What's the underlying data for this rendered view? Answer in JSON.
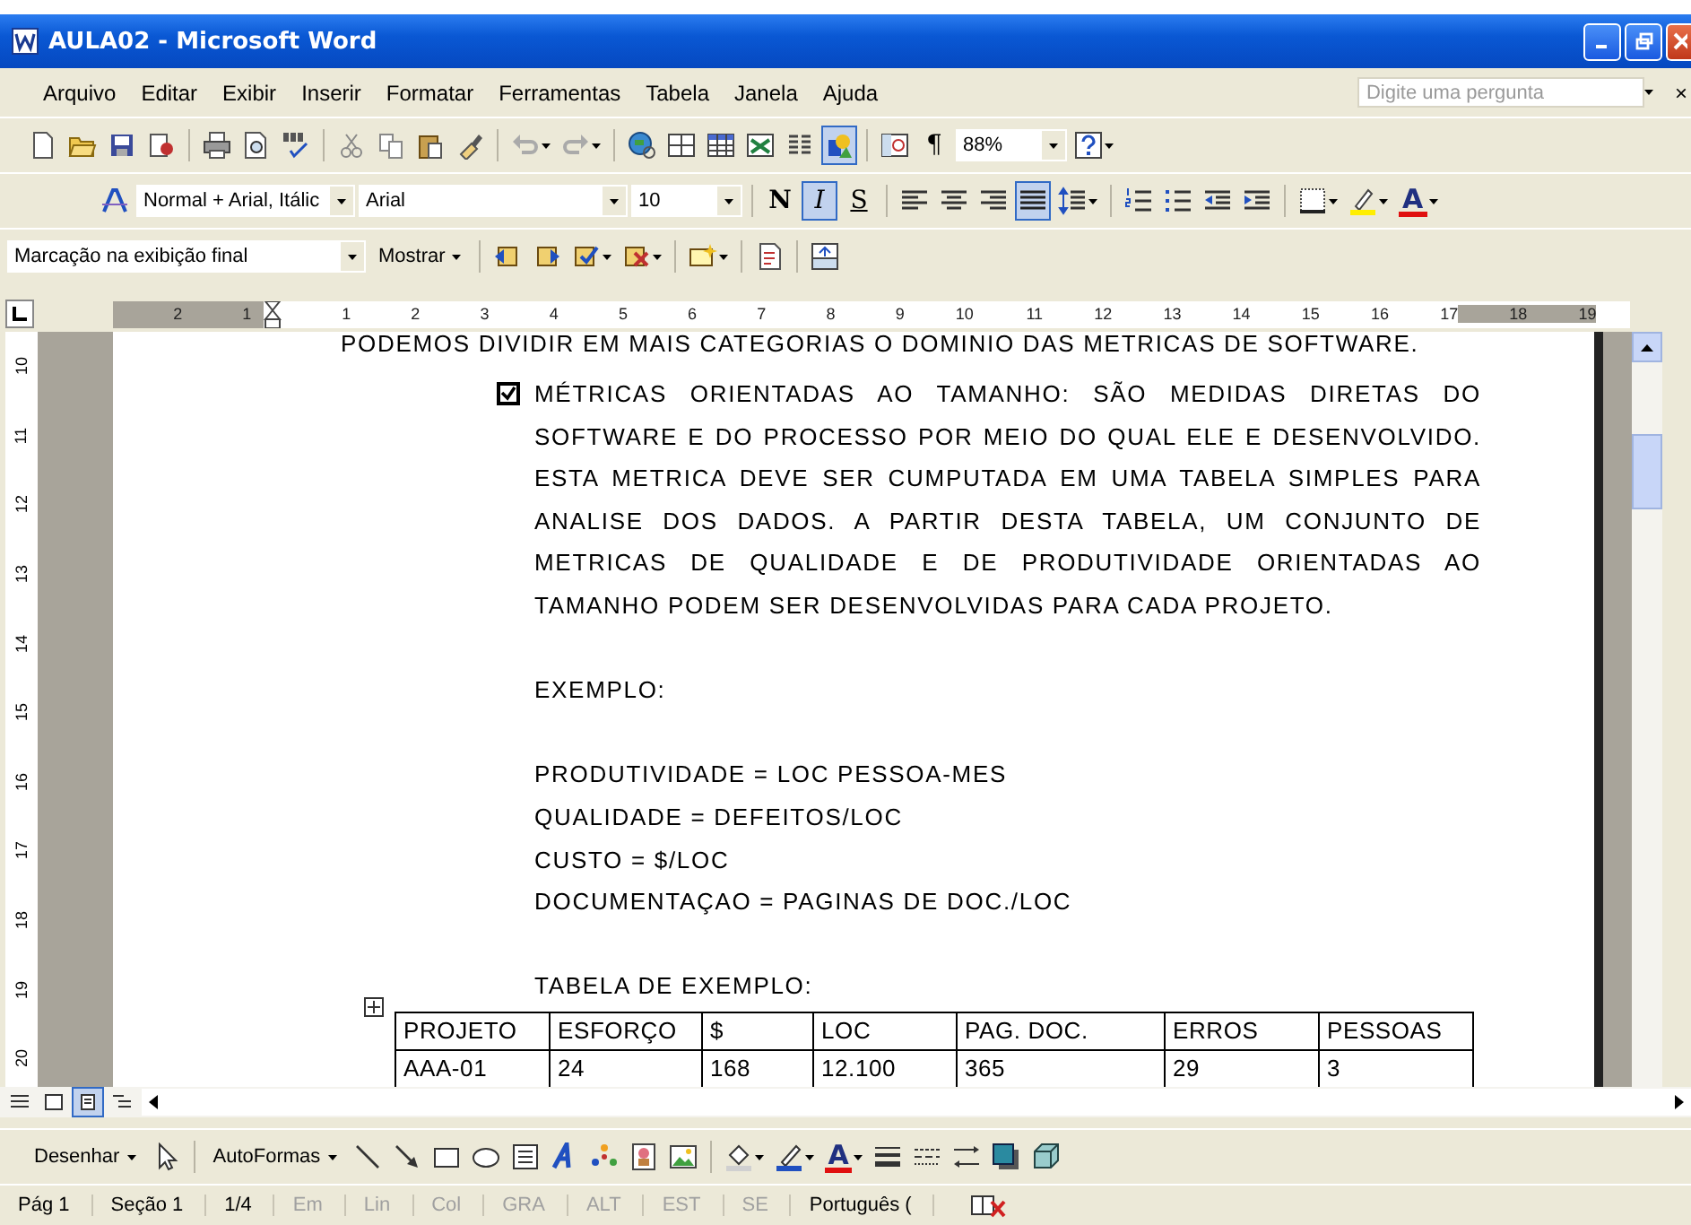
{
  "window": {
    "title": "AULA02 - Microsoft Word"
  },
  "menu": {
    "items": [
      "Arquivo",
      "Editar",
      "Exibir",
      "Inserir",
      "Formatar",
      "Ferramentas",
      "Tabela",
      "Janela",
      "Ajuda"
    ],
    "search": {
      "placeholder": "Digite uma pergunta"
    },
    "close": "×"
  },
  "toolbars": [
    [
      {
        "kind": "icon",
        "pressed": false
      },
      {
        "kind": "icon",
        "pressed": false
      },
      {
        "kind": "icon",
        "pressed": false
      },
      {
        "kind": "icon",
        "pressed": false
      },
      {
        "kind": "sep"
      },
      {
        "kind": "icon",
        "pressed": false
      },
      {
        "kind": "icon",
        "pressed": false
      },
      {
        "kind": "icon",
        "pressed": false
      },
      {
        "kind": "sep"
      },
      {
        "kind": "icon",
        "pressed": false
      },
      {
        "kind": "icon",
        "pressed": false
      },
      {
        "kind": "icon",
        "pressed": false
      },
      {
        "kind": "icon",
        "pressed": false
      },
      {
        "kind": "sep"
      },
      {
        "kind": "icon",
        "pressed": false,
        "dropdown": true
      },
      {
        "kind": "icon",
        "pressed": false,
        "dropdown": true
      },
      {
        "kind": "sep"
      },
      {
        "kind": "icon",
        "pressed": false
      },
      {
        "kind": "icon",
        "pressed": false
      },
      {
        "kind": "icon",
        "pressed": false
      },
      {
        "kind": "icon",
        "pressed": false
      },
      {
        "kind": "icon",
        "pressed": false
      },
      {
        "kind": "icon",
        "pressed": true
      },
      {
        "kind": "sep"
      },
      {
        "kind": "icon",
        "pressed": false
      },
      {
        "kind": "glyph",
        "text": "¶",
        "pressed": false
      },
      {
        "kind": "field",
        "value": "88%"
      },
      {
        "kind": "icon",
        "pressed": false,
        "dropdown": true
      }
    ],
    [
      {
        "kind": "icon",
        "pressed": false
      },
      {
        "kind": "field",
        "value": "Normal + Arial, Itálic"
      },
      {
        "kind": "field",
        "value": "Arial"
      },
      {
        "kind": "field",
        "value": "10"
      },
      {
        "kind": "sep"
      },
      {
        "kind": "glyph",
        "text": "N",
        "pressed": false
      },
      {
        "kind": "glyph",
        "text": "I",
        "pressed": true
      },
      {
        "kind": "glyph",
        "text": "S",
        "pressed": false
      },
      {
        "kind": "sep"
      },
      {
        "kind": "icon",
        "pressed": false
      },
      {
        "kind": "icon",
        "pressed": false
      },
      {
        "kind": "icon",
        "pressed": false
      },
      {
        "kind": "icon",
        "pressed": true
      },
      {
        "kind": "icon",
        "pressed": false,
        "dropdown": true
      },
      {
        "kind": "sep"
      },
      {
        "kind": "icon",
        "pressed": false
      },
      {
        "kind": "icon",
        "pressed": false
      },
      {
        "kind": "icon",
        "pressed": false
      },
      {
        "kind": "icon",
        "pressed": false
      },
      {
        "kind": "sep"
      },
      {
        "kind": "icon",
        "pressed": false,
        "dropdown": true
      },
      {
        "kind": "icon",
        "pressed": false,
        "dropdown": true
      },
      {
        "kind": "glyph",
        "text": "A",
        "pressed": false,
        "dropdown": true
      }
    ],
    [
      {
        "kind": "field",
        "value": "Marcação na exibição final"
      },
      {
        "kind": "menu",
        "label": "Mostrar"
      },
      {
        "kind": "sep"
      },
      {
        "kind": "icon",
        "pressed": false
      },
      {
        "kind": "icon",
        "pressed": false
      },
      {
        "kind": "icon",
        "pressed": false,
        "dropdown": true
      },
      {
        "kind": "icon",
        "pressed": false,
        "dropdown": true
      },
      {
        "kind": "sep"
      },
      {
        "kind": "icon",
        "pressed": false,
        "dropdown": true
      },
      {
        "kind": "sep"
      },
      {
        "kind": "icon",
        "pressed": false
      },
      {
        "kind": "sep"
      },
      {
        "kind": "icon",
        "pressed": false
      }
    ]
  ],
  "ruler": {
    "left_numbers": [
      "2",
      "1"
    ],
    "numbers": [
      "1",
      "2",
      "3",
      "4",
      "5",
      "6",
      "7",
      "8",
      "9",
      "10",
      "11",
      "12",
      "13",
      "14",
      "15",
      "16",
      "17",
      "18",
      "19"
    ],
    "vertical_numbers": [
      "10",
      "11",
      "12",
      "13",
      "14",
      "15",
      "16",
      "17",
      "18",
      "19",
      "20"
    ]
  },
  "document": {
    "blocks": [
      {
        "kind": "cut",
        "text": "PODEMOS DIVIDIR EM MAIS CATEGORIAS O DOMINIO DAS METRICAS DE SOFTWARE."
      },
      {
        "kind": "check",
        "checked": true,
        "text": "MÉTRICAS ORIENTADAS AO TAMANHO: SÃO MEDIDAS DIRETAS DO SOFTWARE E DO PROCESSO POR MEIO DO QUAL ELE E DESENVOLVIDO. ESTA METRICA DEVE SER CUMPUTADA EM UMA TABELA SIMPLES PARA ANALISE DOS DADOS. A PARTIR DESTA TABELA, UM CONJUNTO DE METRICAS DE QUALIDADE E DE PRODUTIVIDADE ORIENTADAS AO TAMANHO PODEM SER DESENVOLVIDAS PARA CADA PROJETO."
      },
      {
        "kind": "blank"
      },
      {
        "kind": "line",
        "text": "EXEMPLO:"
      },
      {
        "kind": "blank"
      },
      {
        "kind": "line",
        "text": "PRODUTIVIDADE = LOC PESSOA-MES"
      },
      {
        "kind": "line",
        "text": "QUALIDADE = DEFEITOS/LOC"
      },
      {
        "kind": "line",
        "text": "CUSTO = $/LOC"
      },
      {
        "kind": "line",
        "text": "DOCUMENTAÇAO = PAGINAS DE DOC./LOC"
      },
      {
        "kind": "blank"
      },
      {
        "kind": "line",
        "text": "TABELA DE EXEMPLO:"
      }
    ],
    "table": {
      "columns": [
        "PROJETO",
        "ESFORÇO",
        "$",
        "LOC",
        "PAG. DOC.",
        "ERROS",
        "PESSOAS"
      ],
      "rows": [
        [
          "AAA-01",
          "24",
          "168",
          "12.100",
          "365",
          "29",
          "3"
        ]
      ]
    }
  },
  "drawing_toolbar": [
    {
      "kind": "menu",
      "label": "Desenhar"
    },
    {
      "kind": "icon"
    },
    {
      "kind": "sep"
    },
    {
      "kind": "menu",
      "label": "AutoFormas"
    },
    {
      "kind": "icon"
    },
    {
      "kind": "icon"
    },
    {
      "kind": "icon"
    },
    {
      "kind": "icon"
    },
    {
      "kind": "icon"
    },
    {
      "kind": "icon"
    },
    {
      "kind": "icon"
    },
    {
      "kind": "icon"
    },
    {
      "kind": "icon"
    },
    {
      "kind": "sep"
    },
    {
      "kind": "icon",
      "dropdown": true
    },
    {
      "kind": "icon",
      "dropdown": true
    },
    {
      "kind": "glyph",
      "text": "A",
      "dropdown": true
    },
    {
      "kind": "icon"
    },
    {
      "kind": "icon"
    },
    {
      "kind": "icon"
    },
    {
      "kind": "icon"
    },
    {
      "kind": "icon"
    }
  ],
  "status_bar": [
    {
      "text": "Pág 1",
      "disabled": false
    },
    {
      "text": "Seção 1",
      "disabled": false
    },
    {
      "text": "1/4",
      "disabled": false
    },
    {
      "text": "Em",
      "disabled": true
    },
    {
      "text": "Lin",
      "disabled": true
    },
    {
      "text": "Col",
      "disabled": true
    },
    {
      "text": "GRA",
      "disabled": true
    },
    {
      "text": "ALT",
      "disabled": true
    },
    {
      "text": "EST",
      "disabled": true
    },
    {
      "text": "SE",
      "disabled": true
    },
    {
      "text": "Português (",
      "disabled": false
    }
  ]
}
